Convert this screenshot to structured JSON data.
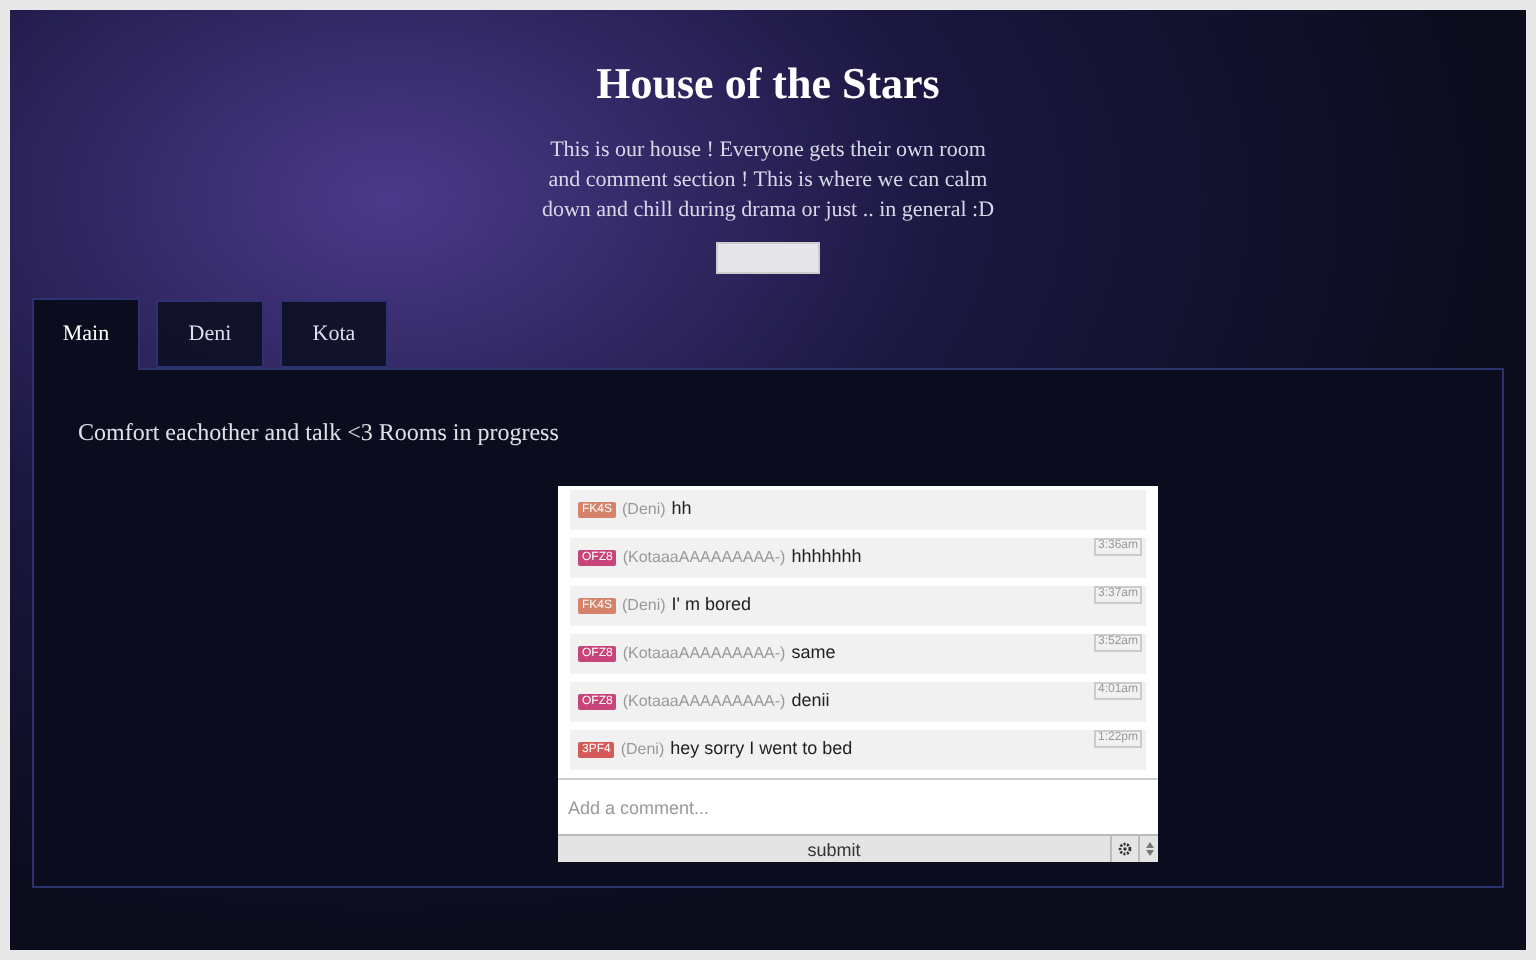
{
  "header": {
    "title": "House of the Stars",
    "description": "This is our house ! Everyone gets their own room and comment section ! This is where we can calm down and chill during drama or just .. in general :D"
  },
  "tabs": [
    {
      "label": "Main",
      "selected": true
    },
    {
      "label": "Deni",
      "selected": false
    },
    {
      "label": "Kota",
      "selected": false
    }
  ],
  "panel": {
    "text": "Comfort eachother and talk <3 Rooms in progress"
  },
  "comments": [
    {
      "badge": "FK4S",
      "color": "#d4826a",
      "author": "(Deni)",
      "text": "hh"
    },
    {
      "badge": "OFZ8",
      "color": "#c8457a",
      "author": "(KotaaaAAAAAAAAA-)",
      "text": "hhhhhhh",
      "time": "3:36am"
    },
    {
      "badge": "FK4S",
      "color": "#d4826a",
      "author": "(Deni)",
      "text": "I' m bored",
      "time": "3:37am"
    },
    {
      "badge": "OFZ8",
      "color": "#c8457a",
      "author": "(KotaaaAAAAAAAAA-)",
      "text": "same",
      "time": "3:52am"
    },
    {
      "badge": "OFZ8",
      "color": "#c8457a",
      "author": "(KotaaaAAAAAAAAA-)",
      "text": "denii",
      "time": "4:01am"
    },
    {
      "badge": "3PF4",
      "color": "#d45a5a",
      "author": "(Deni)",
      "text": "hey sorry I went to bed",
      "time": "1:22pm"
    }
  ],
  "comment_field": {
    "placeholder": "Add a comment..."
  },
  "submit": {
    "label": "submit"
  }
}
